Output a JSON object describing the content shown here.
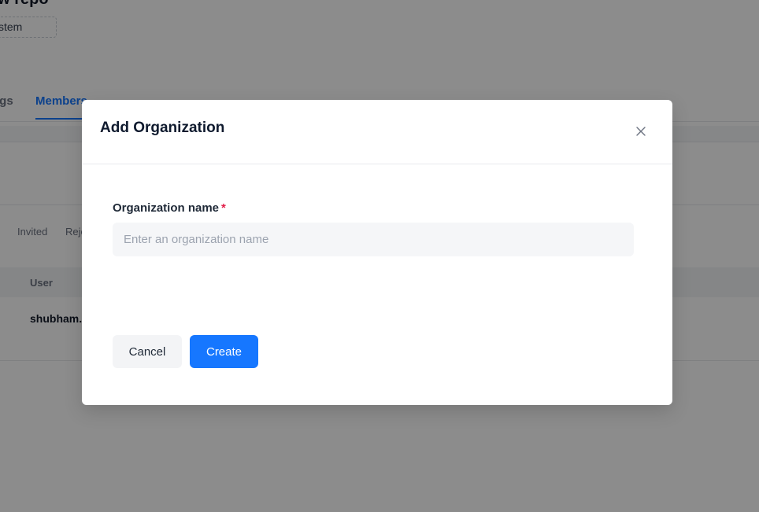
{
  "background": {
    "repo_title": "ew repo",
    "visibility_chip": "ystem",
    "tabs": [
      {
        "label": "ngs"
      },
      {
        "label": "Members"
      }
    ],
    "filters": [
      {
        "label": ")"
      },
      {
        "label": "Invited"
      },
      {
        "label": "Reje"
      }
    ],
    "table": {
      "header_user": "User",
      "row_user": "shubham."
    }
  },
  "modal": {
    "title": "Add Organization",
    "close_icon": "close-icon",
    "field_label": "Organization name",
    "required_mark": "*",
    "input_value": "",
    "input_placeholder": "Enter an organization name",
    "cancel_label": "Cancel",
    "create_label": "Create"
  },
  "colors": {
    "primary": "#1677ff",
    "required": "#e11d48",
    "overlay": "rgba(0,0,0,0.45)"
  }
}
